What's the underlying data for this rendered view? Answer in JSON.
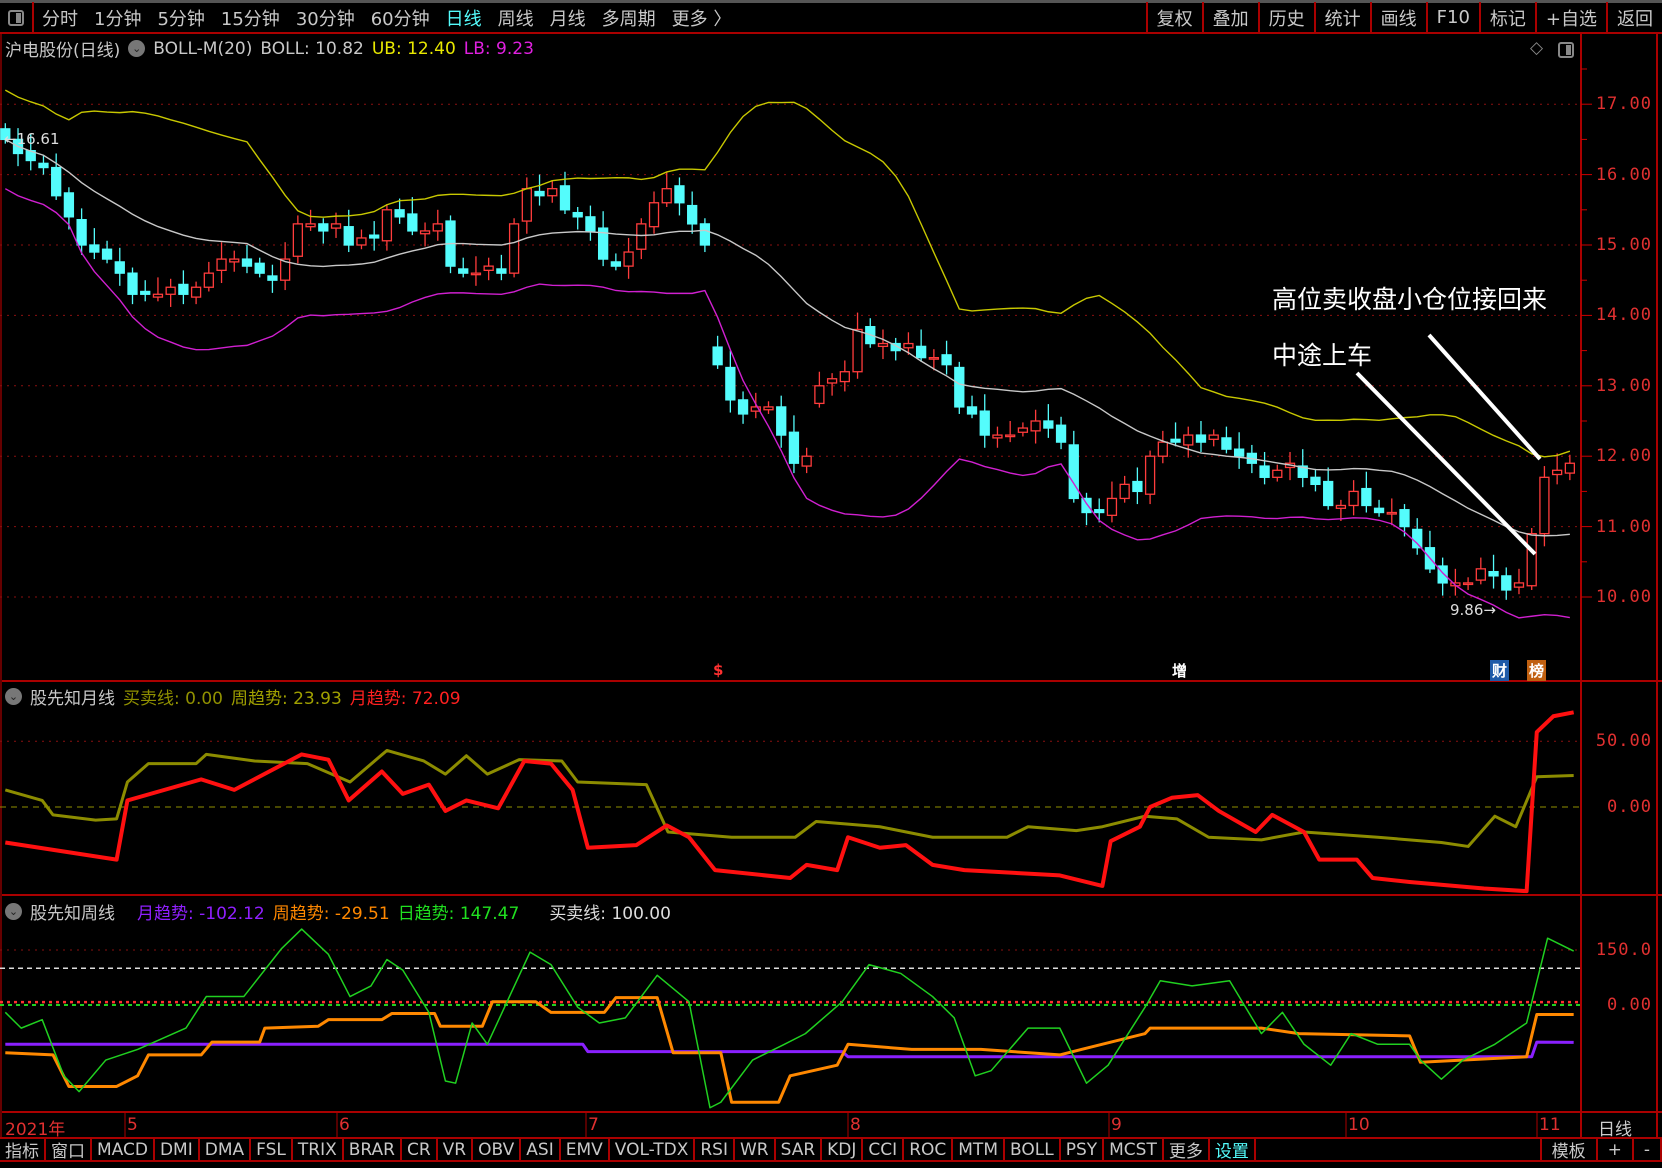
{
  "toolbar": {
    "periods": [
      "分时",
      "1分钟",
      "5分钟",
      "15分钟",
      "30分钟",
      "60分钟",
      "日线",
      "周线",
      "月线",
      "多周期",
      "更多 〉"
    ],
    "active_period": "日线",
    "right": [
      "复权",
      "叠加",
      "历史",
      "统计",
      "画线",
      "F10",
      "标记",
      "+自选",
      "返回"
    ]
  },
  "main": {
    "title": "沪电股份(日线)",
    "indicator": "BOLL-M(20)",
    "boll": "BOLL: 10.82",
    "ub": "UB: 12.40",
    "lb": "LB: 9.23",
    "high_label": "16.61",
    "low_label": "9.86",
    "axis": [
      "17.00",
      "16.00",
      "15.00",
      "14.00",
      "13.00",
      "12.00",
      "11.00",
      "10.00"
    ],
    "annotations": [
      "高位卖收盘小仓位接回来",
      "中途上车"
    ],
    "markers": [
      {
        "text": "$",
        "color": "#ff3030"
      },
      {
        "text": "增",
        "color": "#ffffff"
      },
      {
        "text": "财",
        "color": "#ffffff",
        "bg": "#1e5aa8"
      },
      {
        "text": "榜",
        "color": "#ffffff",
        "bg": "#c06010"
      }
    ],
    "colors": {
      "up": "#ff3c3c",
      "down": "#54fcfc",
      "mid": "#c8c8c8",
      "ub": "#c8c800",
      "lb": "#d020d0"
    }
  },
  "chart_data": {
    "type": "candlestick",
    "closes": [
      16.5,
      16.3,
      16.2,
      16.1,
      15.7,
      15.4,
      15.0,
      14.9,
      14.8,
      14.6,
      14.3,
      14.3,
      14.3,
      14.4,
      14.3,
      14.4,
      14.6,
      14.8,
      14.8,
      14.7,
      14.6,
      14.5,
      14.8,
      15.3,
      15.3,
      15.2,
      15.3,
      15.0,
      15.1,
      15.1,
      15.5,
      15.4,
      15.2,
      15.2,
      15.3,
      14.7,
      14.6,
      14.6,
      14.7,
      14.6,
      15.3,
      15.8,
      15.7,
      15.8,
      15.5,
      15.4,
      15.2,
      14.8,
      14.7,
      14.9,
      15.3,
      15.6,
      15.8,
      15.6,
      15.3,
      15.0,
      13.3,
      12.8,
      12.6,
      12.7,
      12.7,
      12.3,
      11.9,
      12.0,
      13.0,
      13.1,
      13.2,
      13.8,
      13.6,
      13.6,
      13.5,
      13.6,
      13.4,
      13.4,
      13.3,
      12.7,
      12.6,
      12.3,
      12.3,
      12.3,
      12.4,
      12.5,
      12.4,
      12.2,
      11.4,
      11.2,
      11.2,
      11.4,
      11.6,
      11.5,
      12.0,
      12.2,
      12.2,
      12.3,
      12.2,
      12.3,
      12.1,
      12.0,
      11.9,
      11.7,
      11.8,
      11.9,
      11.7,
      11.6,
      11.3,
      11.3,
      11.5,
      11.3,
      11.2,
      11.2,
      11.0,
      10.7,
      10.4,
      10.2,
      10.2,
      10.2,
      10.4,
      10.3,
      10.1,
      10.2,
      10.9,
      11.7,
      11.8,
      11.9
    ]
  },
  "ind1": {
    "name": "股先知月线",
    "line": "买卖线: 0.00",
    "week": "周趋势: 23.93",
    "month": "月趋势: 72.09",
    "axis": [
      "50.00",
      "0.00"
    ],
    "month_series": [
      [
        0,
        -27
      ],
      [
        8.75,
        -40
      ],
      [
        9.6,
        5
      ],
      [
        15.4,
        21
      ],
      [
        18,
        13
      ],
      [
        23.3,
        40
      ],
      [
        25.4,
        36
      ],
      [
        27,
        5
      ],
      [
        29.6,
        27
      ],
      [
        31.25,
        10
      ],
      [
        33.3,
        17
      ],
      [
        34.6,
        -3
      ],
      [
        36.25,
        5
      ],
      [
        38.75,
        -1
      ],
      [
        40.8,
        35
      ],
      [
        42.9,
        33
      ],
      [
        44.6,
        13
      ],
      [
        45.8,
        -31
      ],
      [
        49.6,
        -29
      ],
      [
        52,
        -14
      ],
      [
        53.75,
        -23
      ],
      [
        55.8,
        -48
      ],
      [
        61.7,
        -54
      ],
      [
        63,
        -44
      ],
      [
        65.4,
        -48
      ],
      [
        66.25,
        -23
      ],
      [
        68.75,
        -31
      ],
      [
        70.8,
        -29
      ],
      [
        72.9,
        -44
      ],
      [
        75.4,
        -48
      ],
      [
        82.9,
        -52
      ],
      [
        86.25,
        -60
      ],
      [
        86.9,
        -26
      ],
      [
        89.2,
        -15
      ],
      [
        90,
        0
      ],
      [
        91.7,
        7
      ],
      [
        93.75,
        9
      ],
      [
        95.4,
        -3
      ],
      [
        98.3,
        -19
      ],
      [
        99.6,
        -6
      ],
      [
        102.1,
        -19
      ],
      [
        103.3,
        -40
      ],
      [
        106.25,
        -40
      ],
      [
        107.5,
        -54
      ],
      [
        110.4,
        -57
      ],
      [
        116.25,
        -62
      ],
      [
        119.6,
        -64
      ],
      [
        120.4,
        57
      ],
      [
        121.7,
        69
      ],
      [
        123.3,
        72
      ]
    ],
    "week_series": [
      [
        0,
        13
      ],
      [
        2.9,
        5
      ],
      [
        3.75,
        -6
      ],
      [
        7.1,
        -10
      ],
      [
        8.75,
        -9
      ],
      [
        9.6,
        19
      ],
      [
        11.25,
        33
      ],
      [
        15,
        33
      ],
      [
        15.8,
        40
      ],
      [
        19.6,
        35
      ],
      [
        23.75,
        33
      ],
      [
        27.1,
        19
      ],
      [
        30,
        43
      ],
      [
        32.9,
        35
      ],
      [
        34.6,
        25
      ],
      [
        36.25,
        39
      ],
      [
        37.9,
        25
      ],
      [
        40.4,
        36
      ],
      [
        43.75,
        35
      ],
      [
        45,
        19
      ],
      [
        50.4,
        17
      ],
      [
        52.1,
        -19
      ],
      [
        57.1,
        -23
      ],
      [
        62.1,
        -23
      ],
      [
        63.75,
        -11
      ],
      [
        68.75,
        -15
      ],
      [
        72.9,
        -23
      ],
      [
        78.75,
        -23
      ],
      [
        80.4,
        -15
      ],
      [
        84.2,
        -18
      ],
      [
        86.25,
        -15
      ],
      [
        89.6,
        -7
      ],
      [
        92.1,
        -9
      ],
      [
        94.6,
        -23
      ],
      [
        98.75,
        -25
      ],
      [
        102.1,
        -19
      ],
      [
        107.9,
        -23
      ],
      [
        112.9,
        -27
      ],
      [
        115,
        -30
      ],
      [
        117.1,
        -7
      ],
      [
        118.75,
        -15
      ],
      [
        120.4,
        23
      ],
      [
        123.3,
        24
      ]
    ],
    "buy_sell": 0
  },
  "ind2": {
    "name": "股先知周线",
    "month": "月趋势: -102.12",
    "week": "周趋势: -29.51",
    "day": "日趋势: 147.47",
    "line": "买卖线: 100.00",
    "axis": [
      "150.0",
      "0.00"
    ],
    "month_series": [
      [
        0,
        -107
      ],
      [
        45.4,
        -107
      ],
      [
        45.8,
        -127
      ],
      [
        65.8,
        -127
      ],
      [
        66.25,
        -141
      ],
      [
        120,
        -141
      ],
      [
        120.4,
        -101
      ],
      [
        123.3,
        -102
      ]
    ],
    "week_series": [
      [
        0,
        -130
      ],
      [
        3.75,
        -136
      ],
      [
        5,
        -222
      ],
      [
        8.75,
        -222
      ],
      [
        10.4,
        -193
      ],
      [
        11.25,
        -136
      ],
      [
        15.4,
        -136
      ],
      [
        16.25,
        -101
      ],
      [
        20,
        -101
      ],
      [
        20.4,
        -63
      ],
      [
        24.6,
        -58
      ],
      [
        25.4,
        -40
      ],
      [
        29.6,
        -40
      ],
      [
        30.4,
        -23
      ],
      [
        33.75,
        -23
      ],
      [
        34.2,
        -58
      ],
      [
        37.5,
        -58
      ],
      [
        38.3,
        9
      ],
      [
        41.7,
        9
      ],
      [
        42.9,
        -20
      ],
      [
        47.1,
        -20
      ],
      [
        48,
        20
      ],
      [
        51.25,
        20
      ],
      [
        52.5,
        -130
      ],
      [
        56.25,
        -130
      ],
      [
        57.1,
        -265
      ],
      [
        60.8,
        -265
      ],
      [
        61.7,
        -193
      ],
      [
        65.4,
        -164
      ],
      [
        66.25,
        -107
      ],
      [
        71.25,
        -121
      ],
      [
        76.7,
        -121
      ],
      [
        82.9,
        -136
      ],
      [
        84.6,
        -121
      ],
      [
        89.6,
        -78
      ],
      [
        90,
        -63
      ],
      [
        98.75,
        -63
      ],
      [
        101.7,
        -78
      ],
      [
        110.4,
        -84
      ],
      [
        111.25,
        -156
      ],
      [
        119.6,
        -141
      ],
      [
        120.4,
        -26
      ],
      [
        123.3,
        -26
      ]
    ],
    "day_series": [
      [
        0,
        -20
      ],
      [
        1.25,
        -63
      ],
      [
        2.9,
        -40
      ],
      [
        4.6,
        -193
      ],
      [
        5.8,
        -236
      ],
      [
        7.9,
        -150
      ],
      [
        10.4,
        -121
      ],
      [
        14.2,
        -63
      ],
      [
        15.8,
        23
      ],
      [
        18.75,
        23
      ],
      [
        21.7,
        153
      ],
      [
        23.3,
        207
      ],
      [
        25.4,
        138
      ],
      [
        27.1,
        23
      ],
      [
        28.75,
        52
      ],
      [
        30,
        124
      ],
      [
        31.25,
        95
      ],
      [
        33.3,
        -20
      ],
      [
        34.6,
        -207
      ],
      [
        35.4,
        -213
      ],
      [
        36.7,
        -49
      ],
      [
        37.9,
        -107
      ],
      [
        41.25,
        144
      ],
      [
        42.9,
        110
      ],
      [
        45,
        -6
      ],
      [
        46.7,
        -49
      ],
      [
        48.75,
        -35
      ],
      [
        51.25,
        81
      ],
      [
        53.75,
        9
      ],
      [
        55.4,
        -280
      ],
      [
        56.25,
        -265
      ],
      [
        58.75,
        -150
      ],
      [
        61.25,
        -107
      ],
      [
        62.9,
        -78
      ],
      [
        65.8,
        9
      ],
      [
        67.9,
        110
      ],
      [
        70.4,
        86
      ],
      [
        72.9,
        23
      ],
      [
        74.6,
        -35
      ],
      [
        76.25,
        -193
      ],
      [
        77.5,
        -179
      ],
      [
        80.4,
        -63
      ],
      [
        82.9,
        -63
      ],
      [
        85,
        -213
      ],
      [
        86.7,
        -164
      ],
      [
        89.6,
        -6
      ],
      [
        90.8,
        66
      ],
      [
        93.3,
        52
      ],
      [
        96.25,
        66
      ],
      [
        98.75,
        -78
      ],
      [
        100.4,
        -20
      ],
      [
        102.1,
        -107
      ],
      [
        104.2,
        -164
      ],
      [
        105.8,
        -78
      ],
      [
        107.9,
        -107
      ],
      [
        110.4,
        -107
      ],
      [
        111.25,
        -150
      ],
      [
        112.9,
        -202
      ],
      [
        114.6,
        -150
      ],
      [
        117.1,
        -107
      ],
      [
        119.6,
        -49
      ],
      [
        121.25,
        182
      ],
      [
        123.3,
        147
      ]
    ],
    "buy_sell": 100
  },
  "dates": [
    "2021年",
    "5",
    "6",
    "7",
    "8",
    "9",
    "10",
    "11"
  ],
  "date_axis_label": "日线",
  "bottombar": {
    "items": [
      "指标",
      "窗口",
      "MACD",
      "DMI",
      "DMA",
      "FSL",
      "TRIX",
      "BRAR",
      "CR",
      "VR",
      "OBV",
      "ASI",
      "EMV",
      "VOL-TDX",
      "RSI",
      "WR",
      "SAR",
      "KDJ",
      "CCI",
      "ROC",
      "MTM",
      "BOLL",
      "PSY",
      "MCST",
      "更多",
      "设置"
    ],
    "right": [
      "模板",
      "+",
      "-"
    ]
  }
}
